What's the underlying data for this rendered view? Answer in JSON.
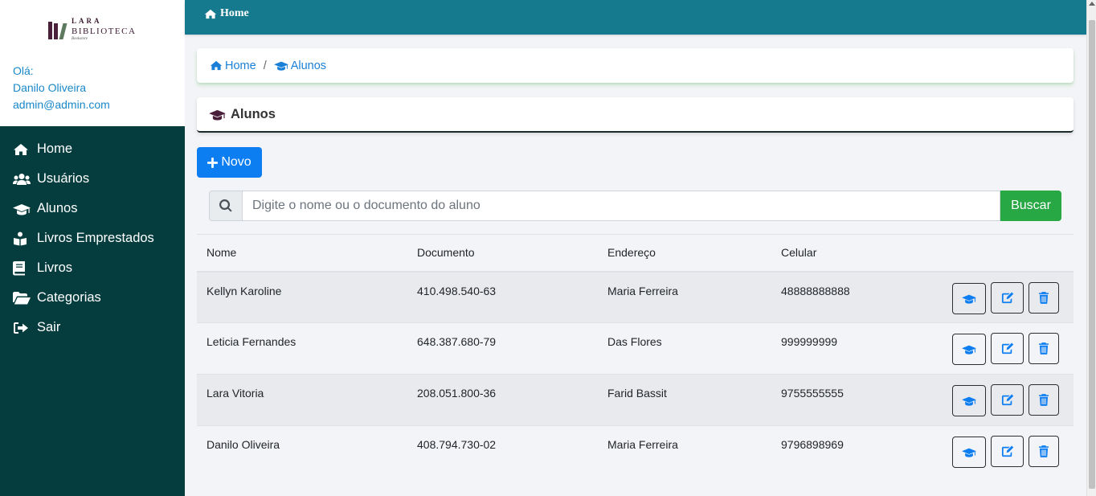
{
  "sidebar": {
    "logo": {
      "line1": "LARA",
      "line2": "BIBLIOTECA",
      "line3": "Bookstore"
    },
    "greeting": "Olá:",
    "user_name": "Danilo Oliveira",
    "user_email": "admin@admin.com",
    "items": [
      {
        "label": "Home",
        "icon": "home-icon"
      },
      {
        "label": "Usuários",
        "icon": "users-icon"
      },
      {
        "label": "Alunos",
        "icon": "graduation-cap-icon"
      },
      {
        "label": "Livros Emprestados",
        "icon": "reader-icon"
      },
      {
        "label": "Livros",
        "icon": "book-icon"
      },
      {
        "label": "Categorias",
        "icon": "folder-open-icon"
      },
      {
        "label": "Sair",
        "icon": "sign-out-icon"
      }
    ]
  },
  "topbar": {
    "home_label": "Home"
  },
  "breadcrumb": {
    "home": "Home",
    "separator": "/",
    "current": "Alunos"
  },
  "page": {
    "title": "Alunos",
    "new_button": "Novo"
  },
  "search": {
    "placeholder": "Digite o nome ou o documento do aluno",
    "button": "Buscar"
  },
  "table": {
    "headers": [
      "Nome",
      "Documento",
      "Endereço",
      "Celular"
    ],
    "rows": [
      {
        "nome": "Kellyn Karoline",
        "documento": "410.498.540-63",
        "endereco": "Maria Ferreira",
        "celular": "48888888888"
      },
      {
        "nome": "Leticia Fernandes",
        "documento": "648.387.680-79",
        "endereco": "Das Flores",
        "celular": "999999999"
      },
      {
        "nome": "Lara Vitoria",
        "documento": "208.051.800-36",
        "endereco": "Farid Bassit",
        "celular": "9755555555"
      },
      {
        "nome": "Danilo Oliveira",
        "documento": "408.794.730-02",
        "endereco": "Maria Ferreira",
        "celular": "9796898969"
      }
    ]
  },
  "colors": {
    "sidebar_bg": "#053d3f",
    "topbar_bg": "#157a8d",
    "primary": "#0d7ef2",
    "success": "#28a745"
  }
}
